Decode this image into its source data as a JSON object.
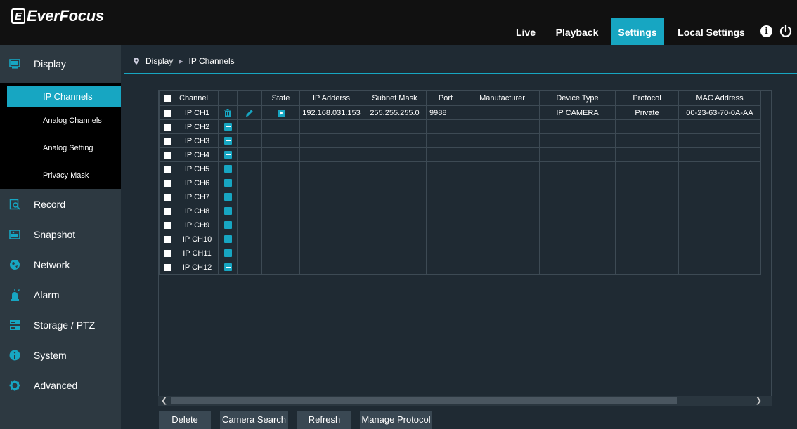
{
  "brand": {
    "logo_mark": "E",
    "logo_text": "EverFocus"
  },
  "topnav": {
    "live": "Live",
    "playback": "Playback",
    "settings": "Settings",
    "local_settings": "Local Settings",
    "info_icon": "i",
    "active_color": "#17a6c2"
  },
  "sidebar": {
    "display": "Display",
    "sub": {
      "ip_channels": "IP Channels",
      "analog_channels": "Analog Channels",
      "analog_setting": "Analog Setting",
      "privacy_mask": "Privacy Mask"
    },
    "record": "Record",
    "snapshot": "Snapshot",
    "network": "Network",
    "alarm": "Alarm",
    "storage_ptz": "Storage / PTZ",
    "system": "System",
    "advanced": "Advanced"
  },
  "breadcrumb": {
    "root": "Display",
    "current": "IP Channels"
  },
  "table": {
    "headers": {
      "channel": "Channel",
      "state": "State",
      "ip": "IP Adderss",
      "subnet": "Subnet Mask",
      "port": "Port",
      "manufacturer": "Manufacturer",
      "device_type": "Device Type",
      "protocol": "Protocol",
      "mac": "MAC Address"
    },
    "rows": [
      {
        "channel": "IP CH1",
        "ip": "192.168.031.153",
        "subnet": "255.255.255.0",
        "port": "9988",
        "manufacturer": "",
        "device_type": "IP CAMERA",
        "protocol": "Private",
        "mac": "00-23-63-70-0A-AA"
      },
      {
        "channel": "IP CH2"
      },
      {
        "channel": "IP CH3"
      },
      {
        "channel": "IP CH4"
      },
      {
        "channel": "IP CH5"
      },
      {
        "channel": "IP CH6"
      },
      {
        "channel": "IP CH7"
      },
      {
        "channel": "IP CH8"
      },
      {
        "channel": "IP CH9"
      },
      {
        "channel": "IP CH10"
      },
      {
        "channel": "IP CH11"
      },
      {
        "channel": "IP CH12"
      }
    ]
  },
  "buttons": {
    "delete": "Delete",
    "camera_search": "Camera Search",
    "refresh": "Refresh",
    "manage_protocol": "Manage Protocol"
  }
}
